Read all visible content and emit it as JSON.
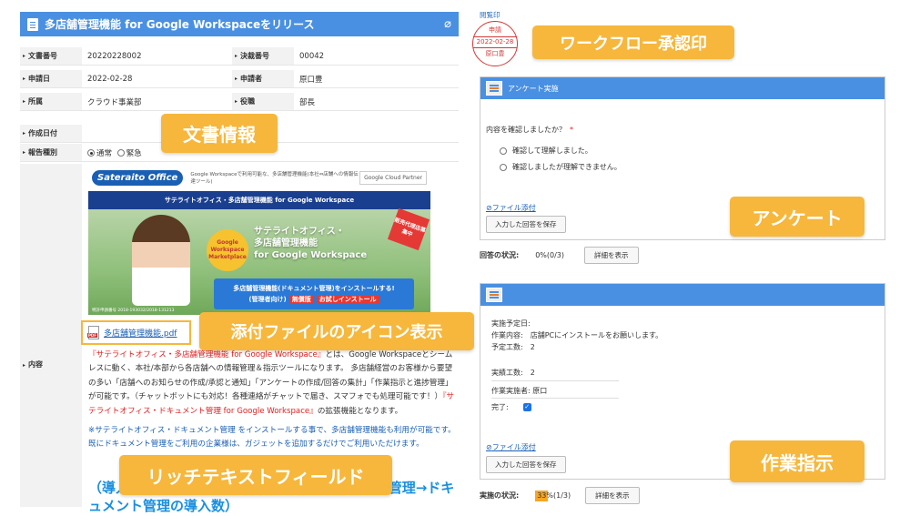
{
  "document": {
    "title": "多店舗管理機能 for Google Workspaceをリリース",
    "fields": {
      "doc_no_label": "文書番号",
      "doc_no": "20220228002",
      "decision_no_label": "決裁番号",
      "decision_no": "00042",
      "apply_date_label": "申請日",
      "apply_date": "2022-02-28",
      "applicant_label": "申請者",
      "applicant": "原口豊",
      "dept_label": "所属",
      "dept": "クラウド事業部",
      "position_label": "役職",
      "position": "部長",
      "created_date_label": "作成日付",
      "report_type_label": "報告種別",
      "report_normal": "通常",
      "report_urgent": "緊急",
      "content_label": "内容"
    },
    "banner": {
      "logo": "Sateraito Office",
      "desc": "Google Workspaceで利用可能な、多店舗管理機能(本社⇔店舗への情報伝達ツール)",
      "partner": "Google Cloud Partner",
      "strip": "サテライトオフィス・多店舗管理機能 for Google Workspace",
      "badge": "Google Workspace Marketplace",
      "headline_1": "サテライトオフィス・",
      "headline_2": "多店舗管理機能",
      "headline_3": "for Google Workspace",
      "sale_tag": "販売代理店募集中",
      "cta_1": "多店舗管理機能(ドキュメント管理)をインストールする!",
      "cta_2": "(管理者向け)",
      "cta_free": "無償版",
      "cta_try": "お試しインストール",
      "patent": "特許申請番号 2018-193032/2018-131213"
    },
    "attachment": "多店舗管理機能.pdf",
    "body_p1_red": "『サテライトオフィス・多店舗管理機能 for Google Workspace』",
    "body_p1_rest": "とは、Google Workspaceとシームレスに動く、本社/本部から各店舗への情報管理＆指示ツールになります。 多店舗経営のお客様から要望の多い「店舗へのお知らせの作成/承認と通知」「アンケートの作成/回答の集計」「作業指示と進捗管理」が可能です。（チャットボットにも対応！各種連絡がチャットで届き、スマフォでも処理可能です！）",
    "body_p1_red2": "『サテライトオフィス・ドキュメント管理 for Google Workspace』",
    "body_p1_tail": "の拡張機能となります。",
    "body_p2": "※サテライトオフィス・ドキュメント管理 をインストールする事で、多店舗管理機能も利用が可能です。既にドキュメント管理をご利用の企業様は、ガジェットを追加するだけでご利用いただけます。",
    "body_big": "（導入方法：サテライトオフィス・ドキュメント管理→ドキュメント管理の導入数）"
  },
  "stamp": {
    "label": "閲覧印",
    "top": "申請",
    "date": "2022-02-28",
    "name": "原口豊"
  },
  "survey": {
    "title": "アンケート実施",
    "question": "内容を確認しましたか？",
    "required_mark": "*",
    "option_1": "確認して理解しました。",
    "option_2": "確認しましたが理解できません。",
    "attach_link": "ファイル添付",
    "save_button": "入力した回答を保存",
    "status_label": "回答の状況:",
    "status_value": "0%(0/3)",
    "detail_button": "詳細を表示"
  },
  "task": {
    "planned_date": "実施予定日:",
    "content": "作業内容:　店舗PCにインストールをお願いします。",
    "planned_effort": "予定工数:　2",
    "actual_effort": "実績工数:　2",
    "worker": "作業実施者: 原口",
    "done": "完了:",
    "attach_link": "ファイル添付",
    "save_button": "入力した回答を保存",
    "status_label": "実施の状況:",
    "status_value": "33%(1/3)",
    "progress": 0.33,
    "detail_button": "詳細を表示"
  },
  "callouts": {
    "workflow": "ワークフロー承認印",
    "doc_info": "文書情報",
    "attachment_icon": "添付ファイルのアイコン表示",
    "survey": "アンケート",
    "task": "作業指示",
    "rich_text": "リッチテキストフィールド"
  },
  "colors": {
    "accent": "#4a90e2",
    "callout": "#f6b73c",
    "stamp": "#d23a3a",
    "link": "#1a5fb4"
  }
}
